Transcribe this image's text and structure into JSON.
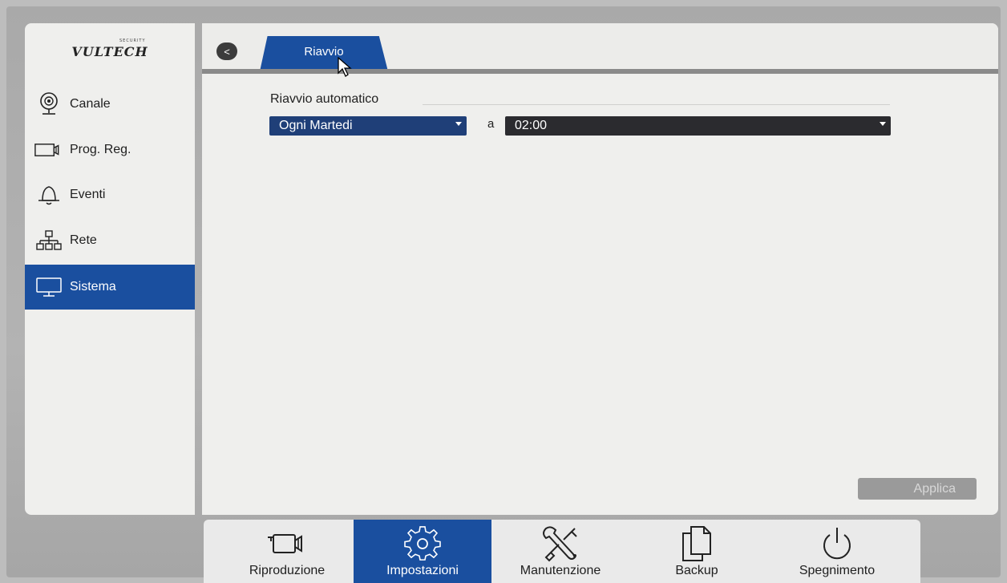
{
  "brand": {
    "name": "VULTECH",
    "sub": "SECURITY"
  },
  "sidebar": {
    "items": [
      {
        "label": "Canale",
        "icon": "camera-icon",
        "active": false
      },
      {
        "label": "Prog. Reg.",
        "icon": "video-camera-icon",
        "active": false
      },
      {
        "label": "Eventi",
        "icon": "bell-icon",
        "active": false
      },
      {
        "label": "Rete",
        "icon": "network-icon",
        "active": false
      },
      {
        "label": "Sistema",
        "icon": "monitor-icon",
        "active": true
      }
    ]
  },
  "header": {
    "back_icon": "chevron-left-icon",
    "back_glyph": "<",
    "tab_label": "Riavvio"
  },
  "form": {
    "section_title": "Riavvio automatico",
    "day_select": "Ogni Martedi",
    "at_label": "a",
    "time_select": "02:00",
    "apply_label": "Applica"
  },
  "toolbar": {
    "items": [
      {
        "label": "Riproduzione",
        "icon": "video-camera-icon",
        "active": false
      },
      {
        "label": "Impostazioni",
        "icon": "gear-icon",
        "active": true
      },
      {
        "label": "Manutenzione",
        "icon": "tools-icon",
        "active": false
      },
      {
        "label": "Backup",
        "icon": "copy-icon",
        "active": false
      },
      {
        "label": "Spegnimento",
        "icon": "power-icon",
        "active": false
      }
    ]
  },
  "colors": {
    "accent": "#1a4f9f",
    "panel": "#efefed",
    "dark_select": "#2b2b2f",
    "disabled_button": "#9a9a9a"
  }
}
